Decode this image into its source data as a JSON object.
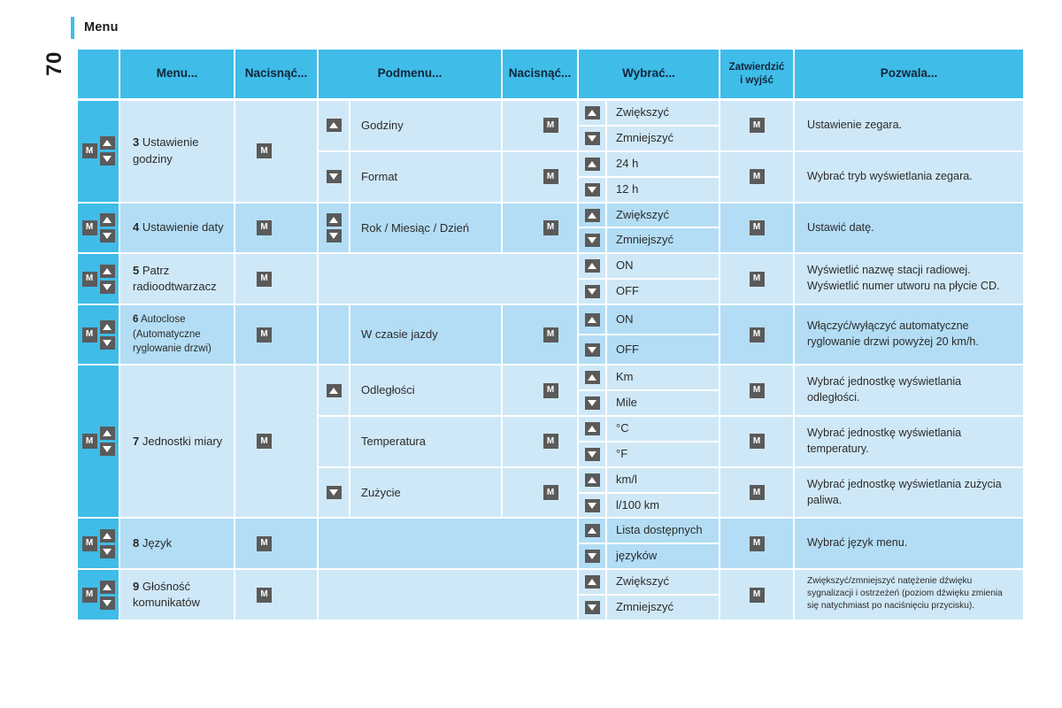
{
  "page_number": "70",
  "heading": "Menu",
  "colors": {
    "accent": "#3fbce8",
    "row_light": "#cfe8f7",
    "row_dark": "#b3ddf5",
    "button": "#5a5a5a"
  },
  "icons": {
    "m_button": "M",
    "up_arrow": "▲",
    "down_arrow": "▼"
  },
  "table": {
    "headers": [
      "",
      "Menu...",
      "Nacisnąć...",
      "Podmenu...",
      "Nacisnąć...",
      "Wybrać...",
      "Zatwierdzić i wyjść",
      "Pozwala..."
    ],
    "header_confirm_line1": "Zatwierdzić",
    "header_confirm_line2": "i wyjść",
    "rows": [
      {
        "num": "3",
        "menu": "Ustawienie godziny",
        "press": "M",
        "submenus": [
          {
            "arrow": "up",
            "label": "Godziny",
            "press": "M",
            "selects": [
              {
                "arrow": "up",
                "label": "Zwiększyć"
              },
              {
                "arrow": "down",
                "label": "Zmniejszyć"
              }
            ],
            "confirm": "M",
            "description": "Ustawienie zegara."
          },
          {
            "arrow": "down",
            "label": "Format",
            "press": "M",
            "selects": [
              {
                "arrow": "up",
                "label": "24 h"
              },
              {
                "arrow": "down",
                "label": "12 h"
              }
            ],
            "confirm": "M",
            "description": "Wybrać tryb wyświetlania zegara."
          }
        ]
      },
      {
        "num": "4",
        "menu": "Ustawienie daty",
        "press": "M",
        "submenus": [
          {
            "arrow": "both",
            "label": "Rok / Miesiąc / Dzień",
            "press": "M",
            "selects": [
              {
                "arrow": "up",
                "label": "Zwiększyć"
              },
              {
                "arrow": "down",
                "label": "Zmniejszyć"
              }
            ],
            "confirm": "M",
            "description": "Ustawić datę."
          }
        ]
      },
      {
        "num": "5",
        "menu": "Patrz radioodtwarzacz",
        "press": "M",
        "submenus": [
          {
            "arrow": "none",
            "label": "",
            "press": "",
            "selects": [
              {
                "arrow": "up",
                "label": "ON"
              },
              {
                "arrow": "down",
                "label": "OFF"
              }
            ],
            "confirm": "M",
            "description": "Wyświetlić nazwę stacji radiowej. Wyświetlić numer utworu na płycie CD."
          }
        ]
      },
      {
        "num": "6",
        "menu": "Autoclose (Automatyczne ryglowanie drzwi)",
        "press": "M",
        "submenus": [
          {
            "arrow": "none",
            "label": "W czasie jazdy",
            "press": "M",
            "selects": [
              {
                "arrow": "up",
                "label": "ON"
              },
              {
                "arrow": "down",
                "label": "OFF"
              }
            ],
            "confirm": "M",
            "description": "Włączyć/wyłączyć automatyczne ryglowanie drzwi powyżej 20 km/h."
          }
        ]
      },
      {
        "num": "7",
        "menu": "Jednostki miary",
        "press": "M",
        "submenus": [
          {
            "arrow": "up",
            "label": "Odległości",
            "press": "M",
            "selects": [
              {
                "arrow": "up",
                "label": "Km"
              },
              {
                "arrow": "down",
                "label": "Mile"
              }
            ],
            "confirm": "M",
            "description": "Wybrać jednostkę wyświetlania odległości."
          },
          {
            "arrow": "none",
            "label": "Temperatura",
            "press": "M",
            "selects": [
              {
                "arrow": "up",
                "label": "°C"
              },
              {
                "arrow": "down",
                "label": "°F"
              }
            ],
            "confirm": "M",
            "description": "Wybrać jednostkę wyświetlania temperatury."
          },
          {
            "arrow": "down",
            "label": "Zużycie",
            "press": "M",
            "selects": [
              {
                "arrow": "up",
                "label": "km/l"
              },
              {
                "arrow": "down",
                "label": "l/100 km"
              }
            ],
            "confirm": "M",
            "description": "Wybrać jednostkę wyświetlania zużycia paliwa."
          }
        ]
      },
      {
        "num": "8",
        "menu": "Język",
        "press": "M",
        "submenus": [
          {
            "arrow": "none",
            "label": "",
            "press": "",
            "selects": [
              {
                "arrow": "up",
                "label": "Lista dostępnych"
              },
              {
                "arrow": "down",
                "label": "języków"
              }
            ],
            "confirm": "M",
            "description": "Wybrać język menu."
          }
        ]
      },
      {
        "num": "9",
        "menu": "Głośność komunikatów",
        "press": "M",
        "submenus": [
          {
            "arrow": "none",
            "label": "",
            "press": "",
            "selects": [
              {
                "arrow": "up",
                "label": "Zwiększyć"
              },
              {
                "arrow": "down",
                "label": "Zmniejszyć"
              }
            ],
            "confirm": "M",
            "description": "Zwiększyć/zmniejszyć natężenie dźwięku sygnalizacji i ostrzeżeń (poziom dźwięku zmienia się natychmiast po naciśnięciu przycisku)."
          }
        ]
      }
    ]
  }
}
